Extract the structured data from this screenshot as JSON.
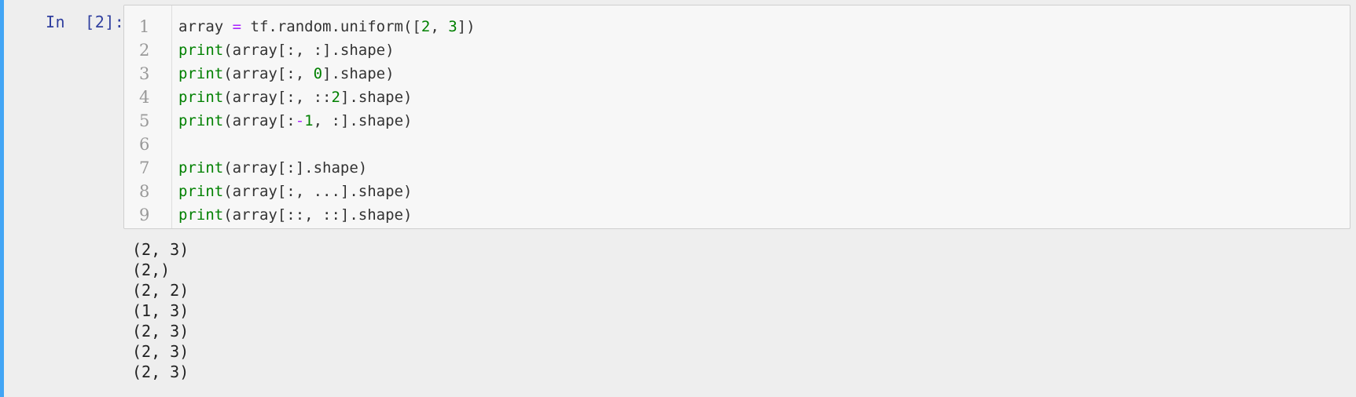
{
  "cell": {
    "prompt": "In  [2]:",
    "accent_color": "#42a5f5",
    "code": {
      "lines": [
        {
          "number": "1",
          "tokens": [
            {
              "text": "array ",
              "kind": "plain"
            },
            {
              "text": "=",
              "kind": "op"
            },
            {
              "text": " tf.random.uniform([",
              "kind": "plain"
            },
            {
              "text": "2",
              "kind": "num"
            },
            {
              "text": ", ",
              "kind": "plain"
            },
            {
              "text": "3",
              "kind": "num"
            },
            {
              "text": "])",
              "kind": "plain"
            }
          ]
        },
        {
          "number": "2",
          "tokens": [
            {
              "text": "print",
              "kind": "builtin"
            },
            {
              "text": "(array[:, :].shape)",
              "kind": "plain"
            }
          ]
        },
        {
          "number": "3",
          "tokens": [
            {
              "text": "print",
              "kind": "builtin"
            },
            {
              "text": "(array[:, ",
              "kind": "plain"
            },
            {
              "text": "0",
              "kind": "num"
            },
            {
              "text": "].shape)",
              "kind": "plain"
            }
          ]
        },
        {
          "number": "4",
          "tokens": [
            {
              "text": "print",
              "kind": "builtin"
            },
            {
              "text": "(array[:, ::",
              "kind": "plain"
            },
            {
              "text": "2",
              "kind": "num"
            },
            {
              "text": "].shape)",
              "kind": "plain"
            }
          ]
        },
        {
          "number": "5",
          "tokens": [
            {
              "text": "print",
              "kind": "builtin"
            },
            {
              "text": "(array[:",
              "kind": "plain"
            },
            {
              "text": "-",
              "kind": "op"
            },
            {
              "text": "1",
              "kind": "num"
            },
            {
              "text": ", :].shape)",
              "kind": "plain"
            }
          ]
        },
        {
          "number": "6",
          "tokens": []
        },
        {
          "number": "7",
          "tokens": [
            {
              "text": "print",
              "kind": "builtin"
            },
            {
              "text": "(array[:].shape)",
              "kind": "plain"
            }
          ]
        },
        {
          "number": "8",
          "tokens": [
            {
              "text": "print",
              "kind": "builtin"
            },
            {
              "text": "(array[:, ...].shape)",
              "kind": "plain"
            }
          ]
        },
        {
          "number": "9",
          "tokens": [
            {
              "text": "print",
              "kind": "builtin"
            },
            {
              "text": "(array[::, ::].shape)",
              "kind": "plain"
            }
          ]
        }
      ]
    },
    "output": [
      "(2, 3)",
      "(2,)",
      "(2, 2)",
      "(1, 3)",
      "(2, 3)",
      "(2, 3)",
      "(2, 3)"
    ]
  }
}
